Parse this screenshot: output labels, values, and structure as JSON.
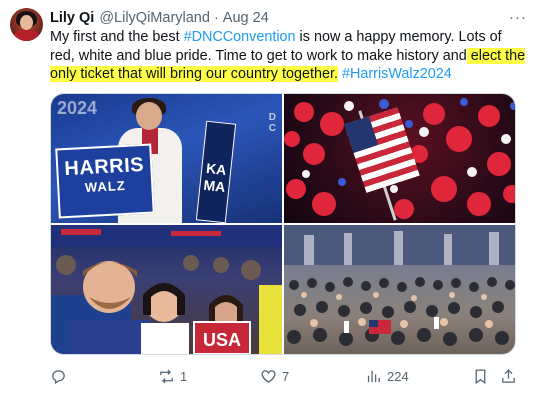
{
  "author": {
    "name": "Lily Qi",
    "handle": "@LilyQiMaryland",
    "separator": "·",
    "date": "Aug 24"
  },
  "menu_label": "···",
  "tweet": {
    "p1": "My first and the best ",
    "hashtag1": "#DNCConvention",
    "p2": " is now a happy memory. Lots of red, white and blue pride. Time to get to work to make history and",
    "highlighted": " elect the only ticket that will bring our country together.",
    "p3": " ",
    "hashtag2": "#HarrisWalz2024",
    "highlight_color": "#ffff45"
  },
  "media": {
    "photo1": {
      "sign_line1": "HARRIS",
      "sign_line2": "WALZ",
      "vertical_sign": "KAMA",
      "banner": "2024",
      "mark": "D\nC"
    },
    "photo4": {},
    "photo3": {
      "sign": "USA"
    }
  },
  "actions": {
    "reply": {
      "icon": "reply-icon",
      "count": ""
    },
    "repost": {
      "icon": "repost-icon",
      "count": "1"
    },
    "like": {
      "icon": "heart-icon",
      "count": "7"
    },
    "views": {
      "icon": "views-icon",
      "count": "224"
    },
    "bookmark": {
      "icon": "bookmark-icon"
    },
    "share": {
      "icon": "share-icon"
    }
  },
  "colors": {
    "link": "#1d9bf0",
    "secondary_text": "#536471",
    "primary_text": "#0f1419"
  }
}
